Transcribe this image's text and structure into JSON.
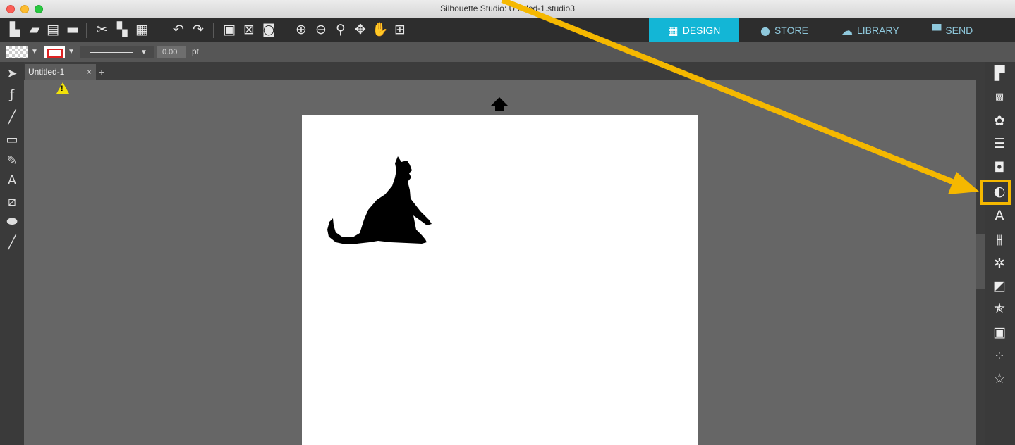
{
  "window": {
    "title": "Silhouette Studio: Untitled-1.studio3"
  },
  "toolbar": {
    "icons": [
      "new-document-icon",
      "open-folder-icon",
      "save-icon",
      "print-icon",
      "cut-icon",
      "copy-icon",
      "paste-icon",
      "undo-icon",
      "redo-icon",
      "group-icon",
      "ungroup-icon",
      "compound-path-icon",
      "zoom-in-icon",
      "zoom-out-icon",
      "zoom-selection-icon",
      "pan-drag-icon",
      "hand-icon",
      "fit-to-page-icon"
    ]
  },
  "nav": {
    "design": "DESIGN",
    "store": "STORE",
    "library": "LIBRARY",
    "send": "SEND",
    "active": "design"
  },
  "properties": {
    "line_width": "0.00",
    "unit": "pt",
    "stroke_color": "#dd2222"
  },
  "tabs": [
    {
      "label": "Untitled-1",
      "close": "×"
    }
  ],
  "tab_add": "+",
  "warning_mark": "!",
  "right_panel": {
    "highlighted": "trace-icon",
    "highlight_color": "#f5b800"
  },
  "annotation": {
    "arrow_color": "#f5b800"
  },
  "colors": {
    "accent": "#13b6d6"
  }
}
